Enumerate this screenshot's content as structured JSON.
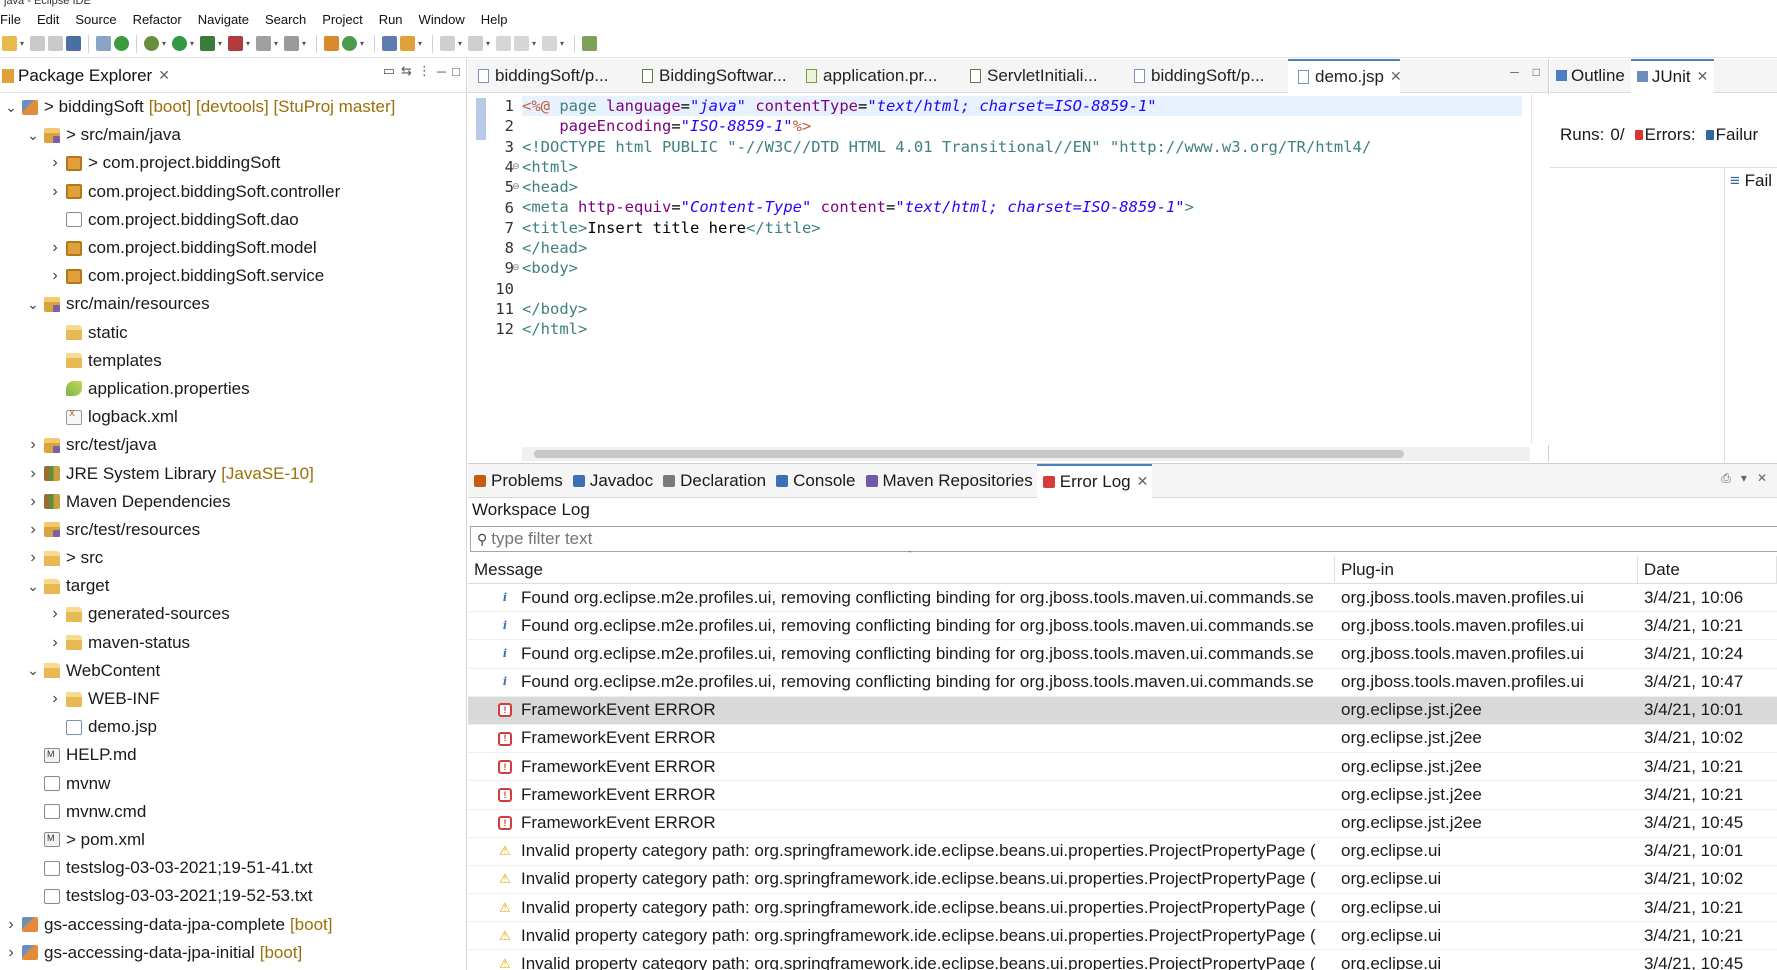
{
  "window": {
    "title": "java - Eclipse IDE"
  },
  "menu": [
    "File",
    "Edit",
    "Source",
    "Refactor",
    "Navigate",
    "Search",
    "Project",
    "Run",
    "Window",
    "Help"
  ],
  "package_explorer": {
    "title": "Package Explorer",
    "items": [
      {
        "label": "> biddingSoft",
        "decor": "[boot] [devtools] [StuProj master]",
        "indent": 0,
        "twisty": "open",
        "icon": "project"
      },
      {
        "label": "> src/main/java",
        "decor": "",
        "indent": 1,
        "twisty": "open",
        "icon": "srcfolder"
      },
      {
        "label": "> com.project.biddingSoft",
        "decor": "",
        "indent": 2,
        "twisty": "closed",
        "icon": "package"
      },
      {
        "label": "com.project.biddingSoft.controller",
        "decor": "",
        "indent": 2,
        "twisty": "closed",
        "icon": "package"
      },
      {
        "label": "com.project.biddingSoft.dao",
        "decor": "",
        "indent": 2,
        "twisty": "none",
        "icon": "emptypkg"
      },
      {
        "label": "com.project.biddingSoft.model",
        "decor": "",
        "indent": 2,
        "twisty": "closed",
        "icon": "package"
      },
      {
        "label": "com.project.biddingSoft.service",
        "decor": "",
        "indent": 2,
        "twisty": "closed",
        "icon": "package"
      },
      {
        "label": "src/main/resources",
        "decor": "",
        "indent": 1,
        "twisty": "open",
        "icon": "srcfolder"
      },
      {
        "label": "static",
        "decor": "",
        "indent": 2,
        "twisty": "none",
        "icon": "folder"
      },
      {
        "label": "templates",
        "decor": "",
        "indent": 2,
        "twisty": "none",
        "icon": "folder"
      },
      {
        "label": "application.properties",
        "decor": "",
        "indent": 2,
        "twisty": "none",
        "icon": "props"
      },
      {
        "label": "logback.xml",
        "decor": "",
        "indent": 2,
        "twisty": "none",
        "icon": "xml"
      },
      {
        "label": "src/test/java",
        "decor": "",
        "indent": 1,
        "twisty": "closed",
        "icon": "srcfolder"
      },
      {
        "label": "JRE System Library",
        "decor": "[JavaSE-10]",
        "indent": 1,
        "twisty": "closed",
        "icon": "library"
      },
      {
        "label": "Maven Dependencies",
        "decor": "",
        "indent": 1,
        "twisty": "closed",
        "icon": "library"
      },
      {
        "label": "src/test/resources",
        "decor": "",
        "indent": 1,
        "twisty": "closed",
        "icon": "srcfolder"
      },
      {
        "label": "> src",
        "decor": "",
        "indent": 1,
        "twisty": "closed",
        "icon": "folder"
      },
      {
        "label": "target",
        "decor": "",
        "indent": 1,
        "twisty": "open",
        "icon": "folder"
      },
      {
        "label": "generated-sources",
        "decor": "",
        "indent": 2,
        "twisty": "closed",
        "icon": "folder"
      },
      {
        "label": "maven-status",
        "decor": "",
        "indent": 2,
        "twisty": "closed",
        "icon": "folder"
      },
      {
        "label": "WebContent",
        "decor": "",
        "indent": 1,
        "twisty": "open",
        "icon": "folder"
      },
      {
        "label": "WEB-INF",
        "decor": "",
        "indent": 2,
        "twisty": "closed",
        "icon": "folder"
      },
      {
        "label": "demo.jsp",
        "decor": "",
        "indent": 2,
        "twisty": "none",
        "icon": "jsp"
      },
      {
        "label": "HELP.md",
        "decor": "",
        "indent": 1,
        "twisty": "none",
        "icon": "md"
      },
      {
        "label": "mvnw",
        "decor": "",
        "indent": 1,
        "twisty": "none",
        "icon": "file"
      },
      {
        "label": "mvnw.cmd",
        "decor": "",
        "indent": 1,
        "twisty": "none",
        "icon": "file"
      },
      {
        "label": "> pom.xml",
        "decor": "",
        "indent": 1,
        "twisty": "none",
        "icon": "md"
      },
      {
        "label": "testslog-03-03-2021;19-51-41.txt",
        "decor": "",
        "indent": 1,
        "twisty": "none",
        "icon": "file"
      },
      {
        "label": "testslog-03-03-2021;19-52-53.txt",
        "decor": "",
        "indent": 1,
        "twisty": "none",
        "icon": "file"
      },
      {
        "label": "gs-accessing-data-jpa-complete",
        "decor": "[boot]",
        "indent": 0,
        "twisty": "closed",
        "icon": "project"
      },
      {
        "label": "gs-accessing-data-jpa-initial",
        "decor": "[boot]",
        "indent": 0,
        "twisty": "closed",
        "icon": "project"
      }
    ]
  },
  "editor": {
    "tabs": [
      {
        "label": "biddingSoft/p...",
        "icon": "jsp",
        "active": false
      },
      {
        "label": "BiddingSoftwar...",
        "icon": "java",
        "active": false
      },
      {
        "label": "application.pr...",
        "icon": "props",
        "active": false
      },
      {
        "label": "ServletInitiali...",
        "icon": "java",
        "active": false
      },
      {
        "label": "biddingSoft/p...",
        "icon": "jsp",
        "active": false
      },
      {
        "label": "demo.jsp",
        "icon": "jsp",
        "active": true
      }
    ],
    "line_numbers": [
      "1",
      "2",
      "3",
      "4",
      "5",
      "6",
      "7",
      "8",
      "9",
      "10",
      "11",
      "12"
    ],
    "fold_lines": [
      3,
      4,
      8
    ],
    "lines": [
      [
        [
          "d",
          "<%@ "
        ],
        [
          "k",
          "page "
        ],
        [
          "a",
          "language"
        ],
        [
          "t",
          "="
        ],
        [
          "s",
          "\"java\""
        ],
        [
          "t",
          " "
        ],
        [
          "a",
          "contentType"
        ],
        [
          "t",
          "="
        ],
        [
          "s",
          "\"text/html; charset=ISO-8859-1\""
        ]
      ],
      [
        [
          "t",
          "    "
        ],
        [
          "a",
          "pageEncoding"
        ],
        [
          "t",
          "="
        ],
        [
          "s",
          "\"ISO-8859-1\""
        ],
        [
          "d",
          "%>"
        ]
      ],
      [
        [
          "dt",
          "<!DOCTYPE html PUBLIC \"-//W3C//DTD HTML 4.01 Transitional//EN\" \"http://www.w3.org/TR/html4/"
        ]
      ],
      [
        [
          "k",
          "<html>"
        ]
      ],
      [
        [
          "k",
          "<head>"
        ]
      ],
      [
        [
          "k",
          "<meta "
        ],
        [
          "a",
          "http-equiv"
        ],
        [
          "t",
          "="
        ],
        [
          "s",
          "\"Content-Type\""
        ],
        [
          "t",
          " "
        ],
        [
          "a",
          "content"
        ],
        [
          "t",
          "="
        ],
        [
          "s",
          "\"text/html; charset=ISO-8859-1\""
        ],
        [
          "k",
          ">"
        ]
      ],
      [
        [
          "k",
          "<title>"
        ],
        [
          "t",
          "Insert title here"
        ],
        [
          "k",
          "</title>"
        ]
      ],
      [
        [
          "k",
          "</head>"
        ]
      ],
      [
        [
          "k",
          "<body>"
        ]
      ],
      [
        [
          "t",
          ""
        ]
      ],
      [
        [
          "k",
          "</body>"
        ]
      ],
      [
        [
          "k",
          "</html>"
        ]
      ]
    ]
  },
  "right_panel": {
    "tabs": [
      {
        "label": "Outline",
        "active": false
      },
      {
        "label": "JUnit",
        "active": true
      }
    ],
    "runs_label": "Runs:",
    "runs_value": "0/",
    "errors_label": "Errors:",
    "failures_label": "Failur",
    "failure_trace_label": "Fail"
  },
  "bottom": {
    "tabs": [
      {
        "label": "Problems",
        "active": false,
        "color": "#c55a11"
      },
      {
        "label": "Javadoc",
        "active": false,
        "color": "#3b6fb6"
      },
      {
        "label": "Declaration",
        "active": false,
        "color": "#7a7a7a"
      },
      {
        "label": "Console",
        "active": false,
        "color": "#3b6fb6"
      },
      {
        "label": "Maven Repositories",
        "active": false,
        "color": "#6e5aa8"
      },
      {
        "label": "Error Log",
        "active": true,
        "color": "#d23c3c"
      }
    ],
    "section_title": "Workspace Log",
    "filter_placeholder": "type filter text",
    "columns": [
      "Message",
      "Plug-in",
      "Date"
    ],
    "rows": [
      {
        "severity": "info",
        "message": "Found org.eclipse.m2e.profiles.ui, removing conflicting binding for org.jboss.tools.maven.ui.commands.se",
        "plugin": "org.jboss.tools.maven.profiles.ui",
        "date": "3/4/21, 10:06",
        "selected": false
      },
      {
        "severity": "info",
        "message": "Found org.eclipse.m2e.profiles.ui, removing conflicting binding for org.jboss.tools.maven.ui.commands.se",
        "plugin": "org.jboss.tools.maven.profiles.ui",
        "date": "3/4/21, 10:21",
        "selected": false
      },
      {
        "severity": "info",
        "message": "Found org.eclipse.m2e.profiles.ui, removing conflicting binding for org.jboss.tools.maven.ui.commands.se",
        "plugin": "org.jboss.tools.maven.profiles.ui",
        "date": "3/4/21, 10:24",
        "selected": false
      },
      {
        "severity": "info",
        "message": "Found org.eclipse.m2e.profiles.ui, removing conflicting binding for org.jboss.tools.maven.ui.commands.se",
        "plugin": "org.jboss.tools.maven.profiles.ui",
        "date": "3/4/21, 10:47",
        "selected": false
      },
      {
        "severity": "error",
        "message": "FrameworkEvent ERROR",
        "plugin": "org.eclipse.jst.j2ee",
        "date": "3/4/21, 10:01",
        "selected": true
      },
      {
        "severity": "error",
        "message": "FrameworkEvent ERROR",
        "plugin": "org.eclipse.jst.j2ee",
        "date": "3/4/21, 10:02",
        "selected": false
      },
      {
        "severity": "error",
        "message": "FrameworkEvent ERROR",
        "plugin": "org.eclipse.jst.j2ee",
        "date": "3/4/21, 10:21",
        "selected": false
      },
      {
        "severity": "error",
        "message": "FrameworkEvent ERROR",
        "plugin": "org.eclipse.jst.j2ee",
        "date": "3/4/21, 10:21",
        "selected": false
      },
      {
        "severity": "error",
        "message": "FrameworkEvent ERROR",
        "plugin": "org.eclipse.jst.j2ee",
        "date": "3/4/21, 10:45",
        "selected": false
      },
      {
        "severity": "warning",
        "message": "Invalid property category path: org.springframework.ide.eclipse.beans.ui.properties.ProjectPropertyPage (",
        "plugin": "org.eclipse.ui",
        "date": "3/4/21, 10:01",
        "selected": false
      },
      {
        "severity": "warning",
        "message": "Invalid property category path: org.springframework.ide.eclipse.beans.ui.properties.ProjectPropertyPage (",
        "plugin": "org.eclipse.ui",
        "date": "3/4/21, 10:02",
        "selected": false
      },
      {
        "severity": "warning",
        "message": "Invalid property category path: org.springframework.ide.eclipse.beans.ui.properties.ProjectPropertyPage (",
        "plugin": "org.eclipse.ui",
        "date": "3/4/21, 10:21",
        "selected": false
      },
      {
        "severity": "warning",
        "message": "Invalid property category path: org.springframework.ide.eclipse.beans.ui.properties.ProjectPropertyPage (",
        "plugin": "org.eclipse.ui",
        "date": "3/4/21, 10:21",
        "selected": false
      },
      {
        "severity": "warning",
        "message": "Invalid property category path: org.springframework.ide.eclipse.beans.ui.properties.ProjectPropertyPage (",
        "plugin": "org.eclipse.ui",
        "date": "3/4/21, 10:45",
        "selected": false
      }
    ]
  }
}
